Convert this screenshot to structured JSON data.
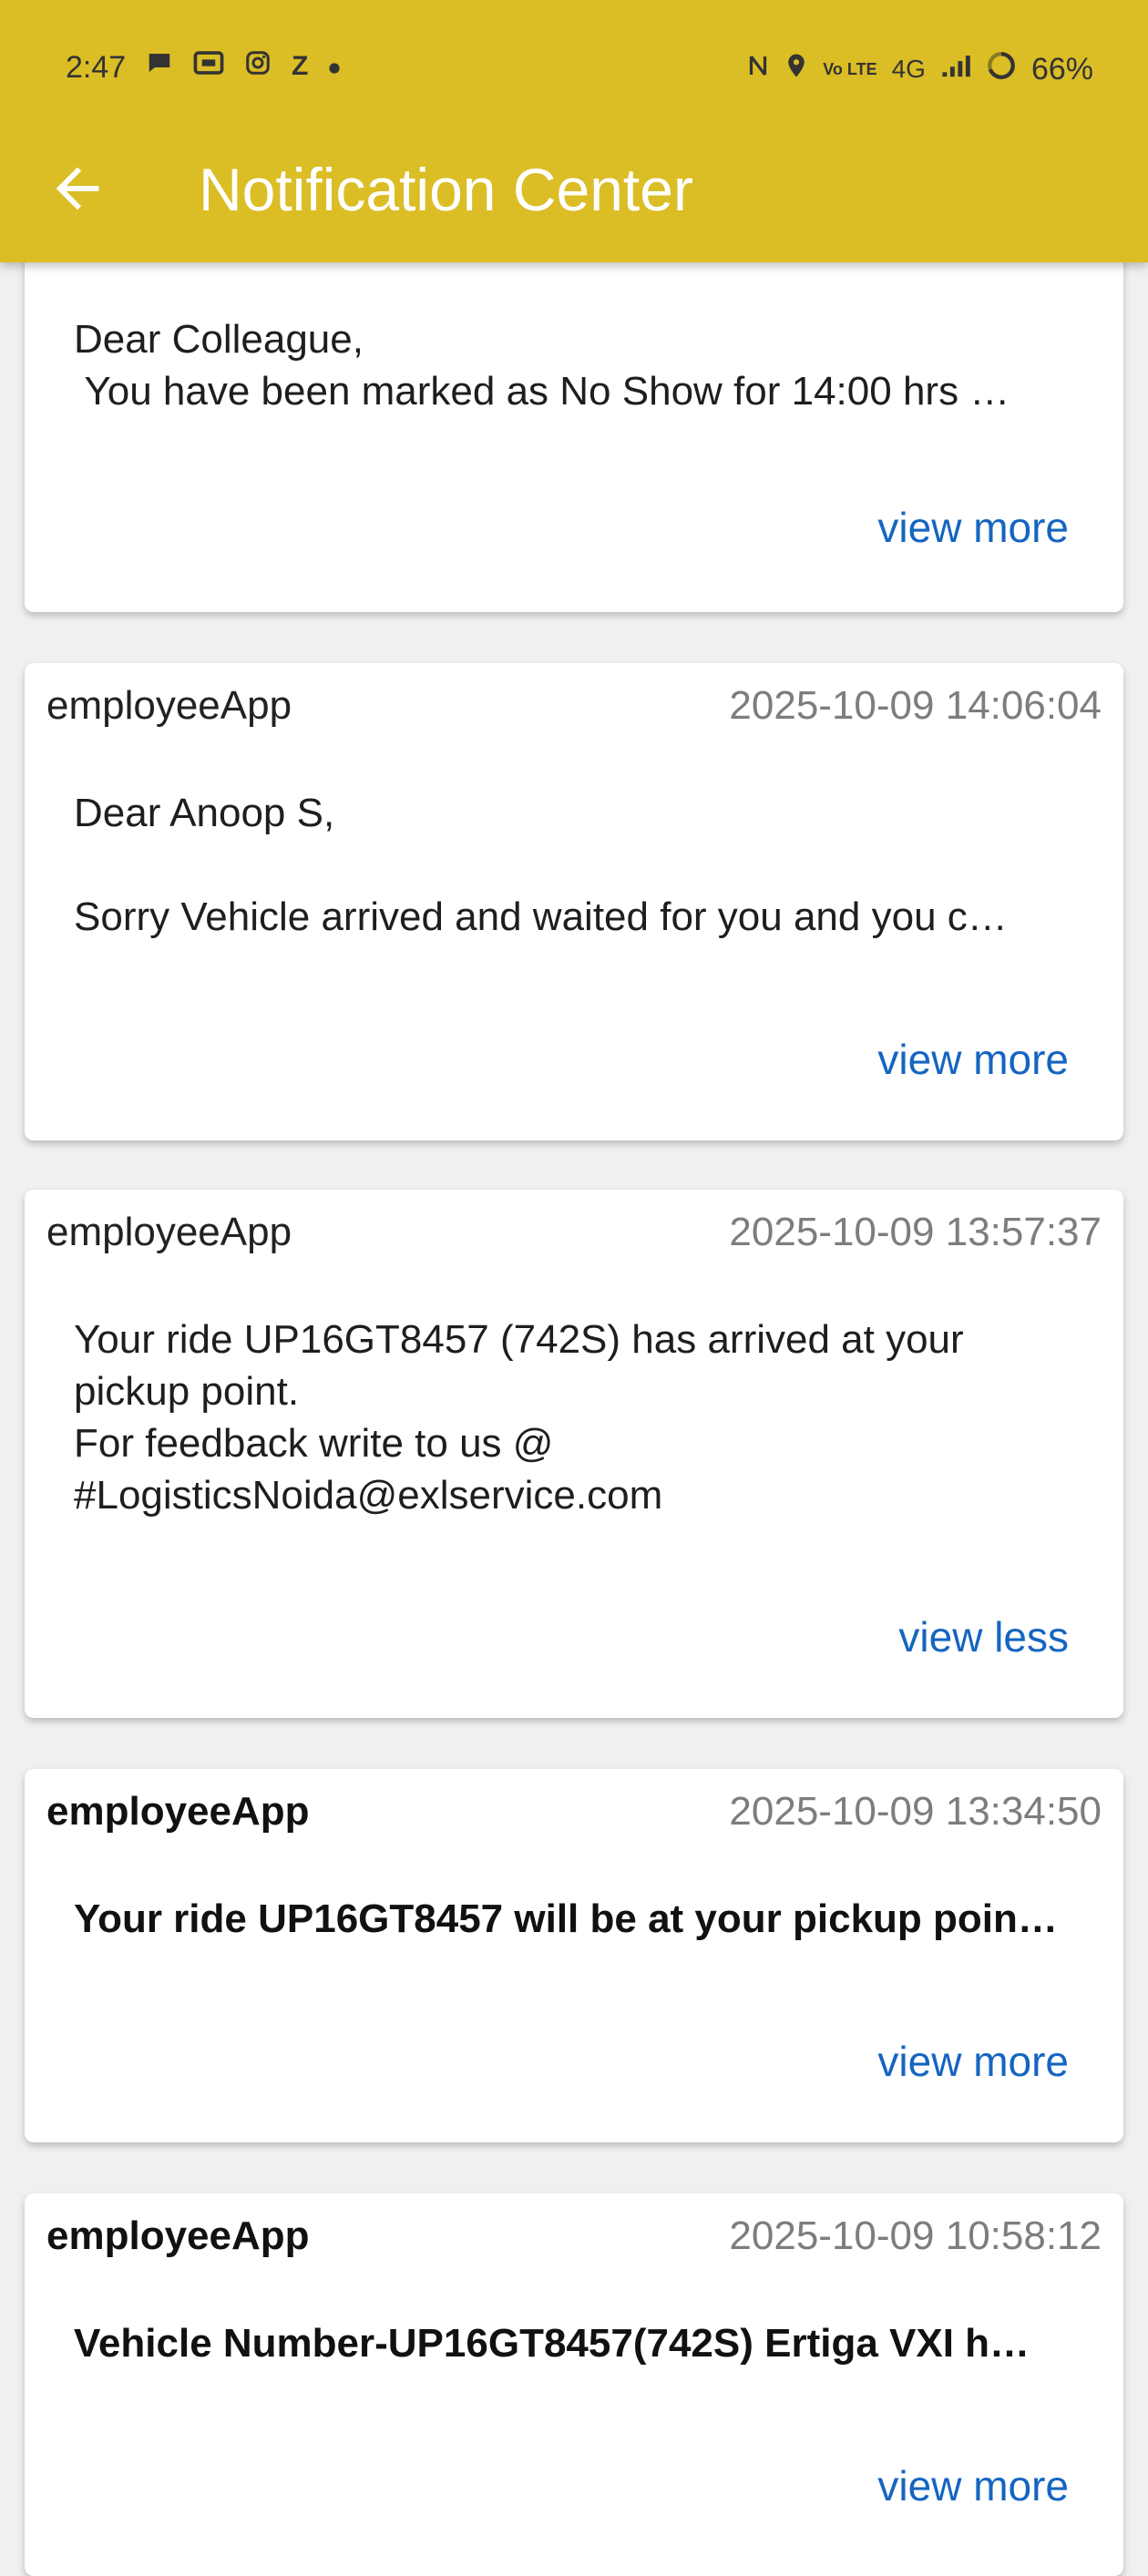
{
  "status_bar": {
    "time": "2:47",
    "battery": "66%",
    "network": "4G",
    "left_icons": [
      "chat-icon",
      "paytm-icon",
      "instagram-icon",
      "zomato-icon",
      "dot-icon"
    ],
    "right_icons": [
      "nfc-icon",
      "location-icon",
      "volte-icon",
      "signal-icon",
      "battery-icon"
    ],
    "left_icon_glyphs": {
      "z": "Z"
    },
    "volte_label": "Vo LTE"
  },
  "appbar": {
    "title": "Notification Center",
    "back_icon": "arrow-left-icon",
    "color": "#dbbd26"
  },
  "notifications": [
    {
      "sender": "",
      "date": "",
      "body": "Dear Colleague,\n You have been marked as No Show for 14:00 hrs …",
      "action": "view more"
    },
    {
      "sender": "employeeApp",
      "date": "2025-10-09 14:06:04",
      "body_line1": "Dear Anoop S,",
      "body_line2": "Sorry Vehicle arrived and waited for you and you c…",
      "action": "view more"
    },
    {
      "sender": "employeeApp",
      "date": "2025-10-09 13:57:37",
      "body": "Your ride UP16GT8457 (742S) has arrived at your\npickup point.\nFor feedback write to us @\n#LogisticsNoida@exlservice.com",
      "action": "view less"
    },
    {
      "sender": "employeeApp",
      "date": "2025-10-09 13:34:50",
      "body": "Your ride UP16GT8457 will be at your pickup poin…",
      "action": "view more"
    },
    {
      "sender": "employeeApp",
      "date": "2025-10-09 10:58:12",
      "body": "Vehicle Number-UP16GT8457(742S) Ertiga VXI h…",
      "action": "view more"
    }
  ],
  "colors": {
    "link": "#1565c0",
    "date": "#7d7d7d",
    "background": "#f0f0f0"
  }
}
